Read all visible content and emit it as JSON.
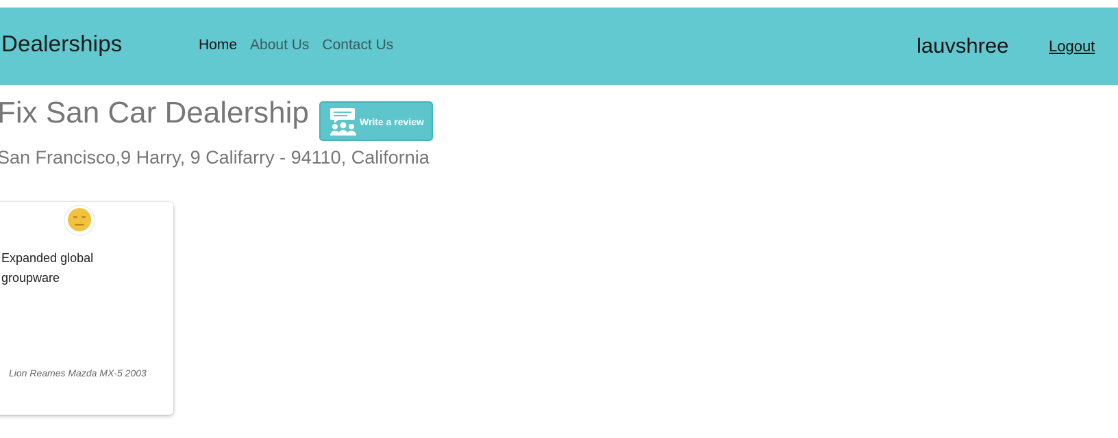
{
  "colors": {
    "navbar": "#61c9cf",
    "review_button": "#5cc6cc",
    "sentiment_face": "#f2c23f"
  },
  "navbar": {
    "brand": "Dealerships",
    "links": [
      {
        "label": "Home"
      },
      {
        "label": "About Us"
      },
      {
        "label": "Contact Us"
      }
    ],
    "username": "lauvshree",
    "logout_label": "Logout"
  },
  "dealer": {
    "name": "Fix San Car Dealership",
    "address": "San Francisco,9 Harry, 9 Califarry   - 94110, California",
    "review_button_label": "Write a review",
    "review_button_icon": "review-people-icon"
  },
  "reviews": [
    {
      "sentiment_icon": "neutral-face-icon",
      "text": "Expanded global groupware",
      "car": "Lion Reames Mazda MX-5 2003"
    }
  ]
}
